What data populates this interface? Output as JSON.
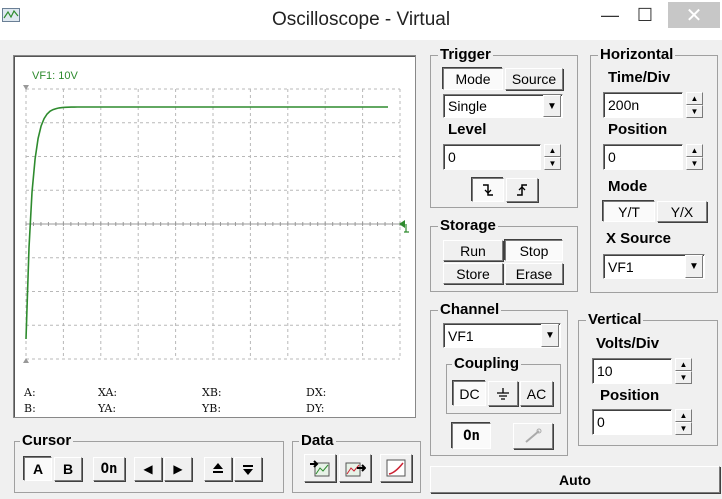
{
  "window": {
    "title": "Oscilloscope - Virtual",
    "min_glyph": "—",
    "max_glyph": "☐",
    "close_glyph": "✕"
  },
  "screen": {
    "channel_label": "VF1: 10V",
    "readouts": {
      "a": "A:",
      "b": "B:",
      "xa": "XA:",
      "ya": "YA:",
      "xb": "XB:",
      "yb": "YB:",
      "dx": "DX:",
      "dy": "DY:"
    }
  },
  "trigger": {
    "title": "Trigger",
    "mode_button": "Mode",
    "source_button": "Source",
    "mode_value": "Single",
    "level_label": "Level",
    "level_value": "0"
  },
  "storage": {
    "title": "Storage",
    "run": "Run",
    "stop": "Stop",
    "store": "Store",
    "erase": "Erase"
  },
  "horizontal": {
    "title": "Horizontal",
    "time_div_label": "Time/Div",
    "time_div_value": "200n",
    "position_label": "Position",
    "position_value": "0",
    "mode_label": "Mode",
    "mode_yt": "Y/T",
    "mode_yx": "Y/X",
    "xsource_label": "X Source",
    "xsource_value": "VF1"
  },
  "channel": {
    "title": "Channel",
    "value": "VF1",
    "coupling_label": "Coupling",
    "dc": "DC",
    "ac": "AC",
    "on": "On"
  },
  "vertical": {
    "title": "Vertical",
    "volts_div_label": "Volts/Div",
    "volts_div_value": "10",
    "position_label": "Position",
    "position_value": "0"
  },
  "cursor": {
    "title": "Cursor",
    "a": "A",
    "b": "B",
    "on": "On"
  },
  "data": {
    "title": "Data"
  },
  "auto_button": "Auto",
  "colors": {
    "trace": "#2e8b2e",
    "grid": "#b8b8b8",
    "label_green": "#2e8b2e"
  }
}
